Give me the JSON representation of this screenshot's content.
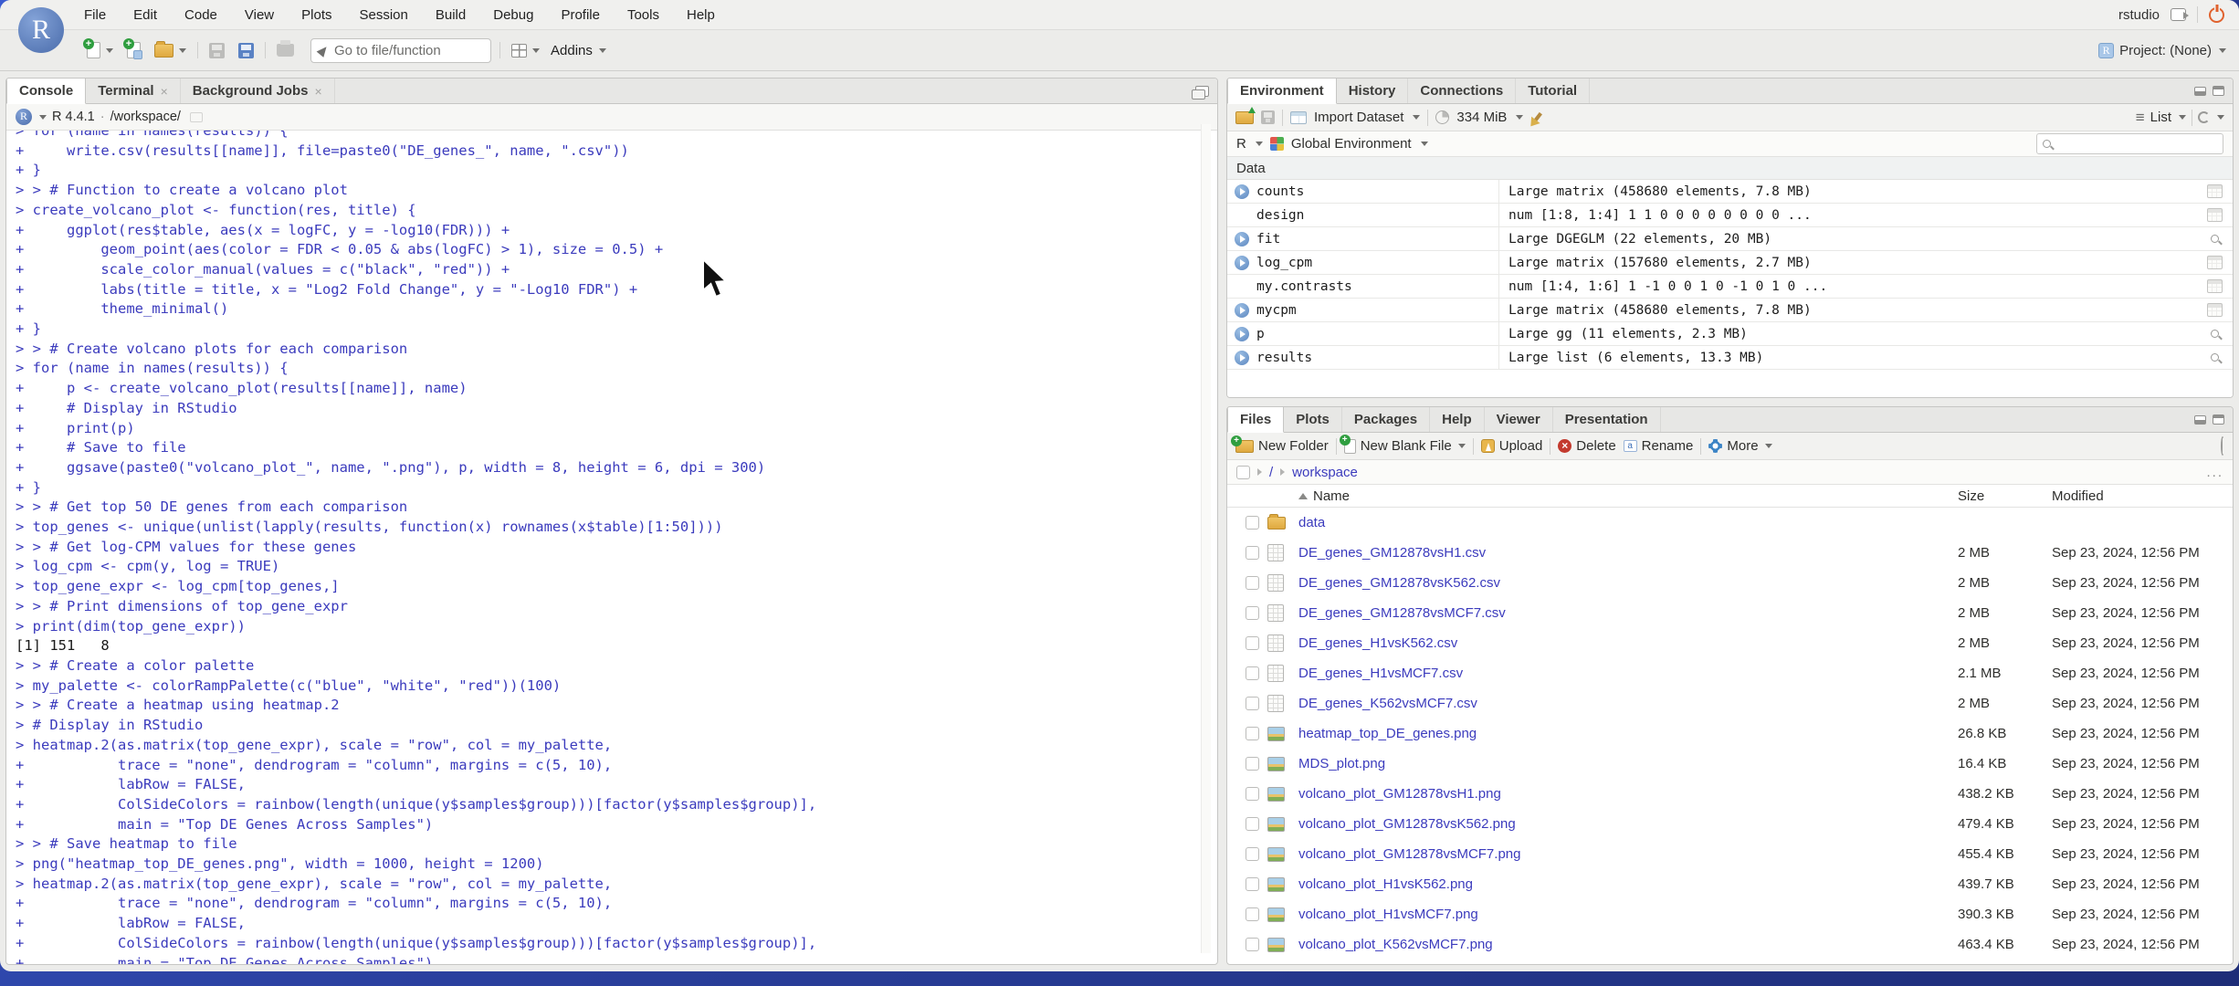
{
  "menubar": {
    "menus": [
      "File",
      "Edit",
      "Code",
      "View",
      "Plots",
      "Session",
      "Build",
      "Debug",
      "Profile",
      "Tools",
      "Help"
    ],
    "server_label": "rstudio",
    "logo_letter": "R"
  },
  "toolbar": {
    "goto_placeholder": "Go to file/function",
    "addins_label": "Addins",
    "project_label": "Project: (None)"
  },
  "console": {
    "tabs": [
      {
        "label": "Console",
        "active": true,
        "closable": false
      },
      {
        "label": "Terminal",
        "active": false,
        "closable": true
      },
      {
        "label": "Background Jobs",
        "active": false,
        "closable": true
      }
    ],
    "r_version": "R 4.4.1",
    "separator": "·",
    "cwd": "/workspace/",
    "lines": [
      {
        "text": "> for (name in names(results)) {",
        "out": false
      },
      {
        "text": "+     write.csv(results[[name]], file=paste0(\"DE_genes_\", name, \".csv\"))",
        "out": false
      },
      {
        "text": "+ }",
        "out": false
      },
      {
        "text": "> > # Function to create a volcano plot",
        "out": false
      },
      {
        "text": "> create_volcano_plot <- function(res, title) {",
        "out": false
      },
      {
        "text": "+     ggplot(res$table, aes(x = logFC, y = -log10(FDR))) +",
        "out": false
      },
      {
        "text": "+         geom_point(aes(color = FDR < 0.05 & abs(logFC) > 1), size = 0.5) +",
        "out": false
      },
      {
        "text": "+         scale_color_manual(values = c(\"black\", \"red\")) +",
        "out": false
      },
      {
        "text": "+         labs(title = title, x = \"Log2 Fold Change\", y = \"-Log10 FDR\") +",
        "out": false
      },
      {
        "text": "+         theme_minimal()",
        "out": false
      },
      {
        "text": "+ }",
        "out": false
      },
      {
        "text": "> > # Create volcano plots for each comparison",
        "out": false
      },
      {
        "text": "> for (name in names(results)) {",
        "out": false
      },
      {
        "text": "+     p <- create_volcano_plot(results[[name]], name)",
        "out": false
      },
      {
        "text": "+     # Display in RStudio",
        "out": false
      },
      {
        "text": "+     print(p)",
        "out": false
      },
      {
        "text": "+     # Save to file",
        "out": false
      },
      {
        "text": "+     ggsave(paste0(\"volcano_plot_\", name, \".png\"), p, width = 8, height = 6, dpi = 300)",
        "out": false
      },
      {
        "text": "+ }",
        "out": false
      },
      {
        "text": "> > # Get top 50 DE genes from each comparison",
        "out": false
      },
      {
        "text": "> top_genes <- unique(unlist(lapply(results, function(x) rownames(x$table)[1:50])))",
        "out": false
      },
      {
        "text": "> > # Get log-CPM values for these genes",
        "out": false
      },
      {
        "text": "> log_cpm <- cpm(y, log = TRUE)",
        "out": false
      },
      {
        "text": "> top_gene_expr <- log_cpm[top_genes,]",
        "out": false
      },
      {
        "text": "> > # Print dimensions of top_gene_expr",
        "out": false
      },
      {
        "text": "> print(dim(top_gene_expr))",
        "out": false
      },
      {
        "text": "[1] 151   8",
        "out": true
      },
      {
        "text": "> > # Create a color palette",
        "out": false
      },
      {
        "text": "> my_palette <- colorRampPalette(c(\"blue\", \"white\", \"red\"))(100)",
        "out": false
      },
      {
        "text": "> > # Create a heatmap using heatmap.2",
        "out": false
      },
      {
        "text": "> # Display in RStudio",
        "out": false
      },
      {
        "text": "> heatmap.2(as.matrix(top_gene_expr), scale = \"row\", col = my_palette,",
        "out": false
      },
      {
        "text": "+           trace = \"none\", dendrogram = \"column\", margins = c(5, 10),",
        "out": false
      },
      {
        "text": "+           labRow = FALSE,",
        "out": false
      },
      {
        "text": "+           ColSideColors = rainbow(length(unique(y$samples$group)))[factor(y$samples$group)],",
        "out": false
      },
      {
        "text": "+           main = \"Top DE Genes Across Samples\")",
        "out": false
      },
      {
        "text": "> > # Save heatmap to file",
        "out": false
      },
      {
        "text": "> png(\"heatmap_top_DE_genes.png\", width = 1000, height = 1200)",
        "out": false
      },
      {
        "text": "> heatmap.2(as.matrix(top_gene_expr), scale = \"row\", col = my_palette,",
        "out": false
      },
      {
        "text": "+           trace = \"none\", dendrogram = \"column\", margins = c(5, 10),",
        "out": false
      },
      {
        "text": "+           labRow = FALSE,",
        "out": false
      },
      {
        "text": "+           ColSideColors = rainbow(length(unique(y$samples$group)))[factor(y$samples$group)],",
        "out": false
      },
      {
        "text": "+           main = \"Top DE Genes Across Samples\")",
        "out": false
      }
    ]
  },
  "environment": {
    "tabs": [
      {
        "label": "Environment",
        "active": true
      },
      {
        "label": "History",
        "active": false
      },
      {
        "label": "Connections",
        "active": false
      },
      {
        "label": "Tutorial",
        "active": false
      }
    ],
    "toolbar": {
      "import_label": "Import Dataset",
      "memory_label": "334 MiB",
      "list_label": "List"
    },
    "scope": {
      "r_label": "R",
      "env_label": "Global Environment"
    },
    "section_label": "Data",
    "rows": [
      {
        "name": "counts",
        "value": "Large matrix (458680 elements,  7.8 MB)",
        "expandable": true,
        "action": "grid"
      },
      {
        "name": "design",
        "value": "num [1:8, 1:4] 1 1 0 0 0 0 0 0 0 0 ...",
        "expandable": false,
        "action": "grid"
      },
      {
        "name": "fit",
        "value": "Large DGEGLM (22 elements,  20 MB)",
        "expandable": true,
        "action": "mag"
      },
      {
        "name": "log_cpm",
        "value": "Large matrix (157680 elements,  2.7 MB)",
        "expandable": true,
        "action": "grid"
      },
      {
        "name": "my.contrasts",
        "value": "num [1:4, 1:6] 1 -1 0 0 1 0 -1 0 1 0 ...",
        "expandable": false,
        "action": "grid"
      },
      {
        "name": "mycpm",
        "value": "Large matrix (458680 elements,  7.8 MB)",
        "expandable": true,
        "action": "grid"
      },
      {
        "name": "p",
        "value": "Large gg (11 elements,  2.3 MB)",
        "expandable": true,
        "action": "mag"
      },
      {
        "name": "results",
        "value": "Large list (6 elements,  13.3 MB)",
        "expandable": true,
        "action": "mag"
      }
    ]
  },
  "files": {
    "tabs": [
      {
        "label": "Files",
        "active": true
      },
      {
        "label": "Plots",
        "active": false
      },
      {
        "label": "Packages",
        "active": false
      },
      {
        "label": "Help",
        "active": false
      },
      {
        "label": "Viewer",
        "active": false
      },
      {
        "label": "Presentation",
        "active": false
      }
    ],
    "toolbar": {
      "new_folder": "New Folder",
      "new_blank_file": "New Blank File",
      "upload": "Upload",
      "delete": "Delete",
      "rename": "Rename",
      "more": "More"
    },
    "breadcrumb": {
      "root": "/",
      "path": "workspace",
      "ellipsis": "..."
    },
    "columns": {
      "name": "Name",
      "size": "Size",
      "modified": "Modified"
    },
    "rows": [
      {
        "type": "folder",
        "name": "data",
        "size": "",
        "modified": ""
      },
      {
        "type": "csv",
        "name": "DE_genes_GM12878vsH1.csv",
        "size": "2 MB",
        "modified": "Sep 23, 2024, 12:56 PM"
      },
      {
        "type": "csv",
        "name": "DE_genes_GM12878vsK562.csv",
        "size": "2 MB",
        "modified": "Sep 23, 2024, 12:56 PM"
      },
      {
        "type": "csv",
        "name": "DE_genes_GM12878vsMCF7.csv",
        "size": "2 MB",
        "modified": "Sep 23, 2024, 12:56 PM"
      },
      {
        "type": "csv",
        "name": "DE_genes_H1vsK562.csv",
        "size": "2 MB",
        "modified": "Sep 23, 2024, 12:56 PM"
      },
      {
        "type": "csv",
        "name": "DE_genes_H1vsMCF7.csv",
        "size": "2.1 MB",
        "modified": "Sep 23, 2024, 12:56 PM"
      },
      {
        "type": "csv",
        "name": "DE_genes_K562vsMCF7.csv",
        "size": "2 MB",
        "modified": "Sep 23, 2024, 12:56 PM"
      },
      {
        "type": "img",
        "name": "heatmap_top_DE_genes.png",
        "size": "26.8 KB",
        "modified": "Sep 23, 2024, 12:56 PM"
      },
      {
        "type": "img",
        "name": "MDS_plot.png",
        "size": "16.4 KB",
        "modified": "Sep 23, 2024, 12:56 PM"
      },
      {
        "type": "img",
        "name": "volcano_plot_GM12878vsH1.png",
        "size": "438.2 KB",
        "modified": "Sep 23, 2024, 12:56 PM"
      },
      {
        "type": "img",
        "name": "volcano_plot_GM12878vsK562.png",
        "size": "479.4 KB",
        "modified": "Sep 23, 2024, 12:56 PM"
      },
      {
        "type": "img",
        "name": "volcano_plot_GM12878vsMCF7.png",
        "size": "455.4 KB",
        "modified": "Sep 23, 2024, 12:56 PM"
      },
      {
        "type": "img",
        "name": "volcano_plot_H1vsK562.png",
        "size": "439.7 KB",
        "modified": "Sep 23, 2024, 12:56 PM"
      },
      {
        "type": "img",
        "name": "volcano_plot_H1vsMCF7.png",
        "size": "390.3 KB",
        "modified": "Sep 23, 2024, 12:56 PM"
      },
      {
        "type": "img",
        "name": "volcano_plot_K562vsMCF7.png",
        "size": "463.4 KB",
        "modified": "Sep 23, 2024, 12:56 PM"
      }
    ]
  }
}
